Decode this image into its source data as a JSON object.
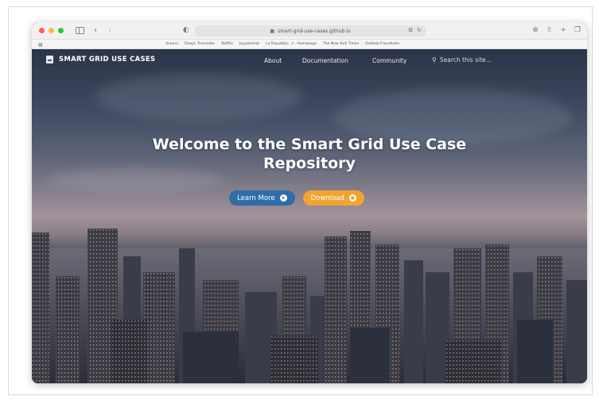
{
  "browser": {
    "url": "smart-grid-use-cases.github.io",
    "bookmarks": [
      "draw.io",
      "DeepL Translator",
      "Netflix",
      "JupyterHub",
      "La Repubblic...t - Homepage",
      "The New York Times",
      "Outlook Fraunhofer"
    ]
  },
  "nav": {
    "brand": "SMART GRID USE CASES",
    "links": [
      "About",
      "Documentation",
      "Community"
    ],
    "search_placeholder": "Search this site..."
  },
  "hero": {
    "headline_line1": "Welcome to the Smart Grid Use Case",
    "headline_line2": "Repository",
    "learn_more": "Learn More",
    "download": "Download"
  },
  "colors": {
    "learn_more_bg": "#2f6da8",
    "download_bg": "#f2a430",
    "light_red": "#fe5f57",
    "light_yellow": "#febc2e",
    "light_green": "#28c840"
  },
  "icons": [
    "sidebar-icon",
    "back-icon",
    "forward-icon",
    "shield-icon",
    "lock-icon",
    "translate-icon",
    "reload-icon",
    "download-icon",
    "share-icon",
    "new-tab-icon",
    "tabs-overview-icon",
    "grid-icon",
    "search-icon",
    "circle-arrow-icon",
    "github-icon"
  ]
}
